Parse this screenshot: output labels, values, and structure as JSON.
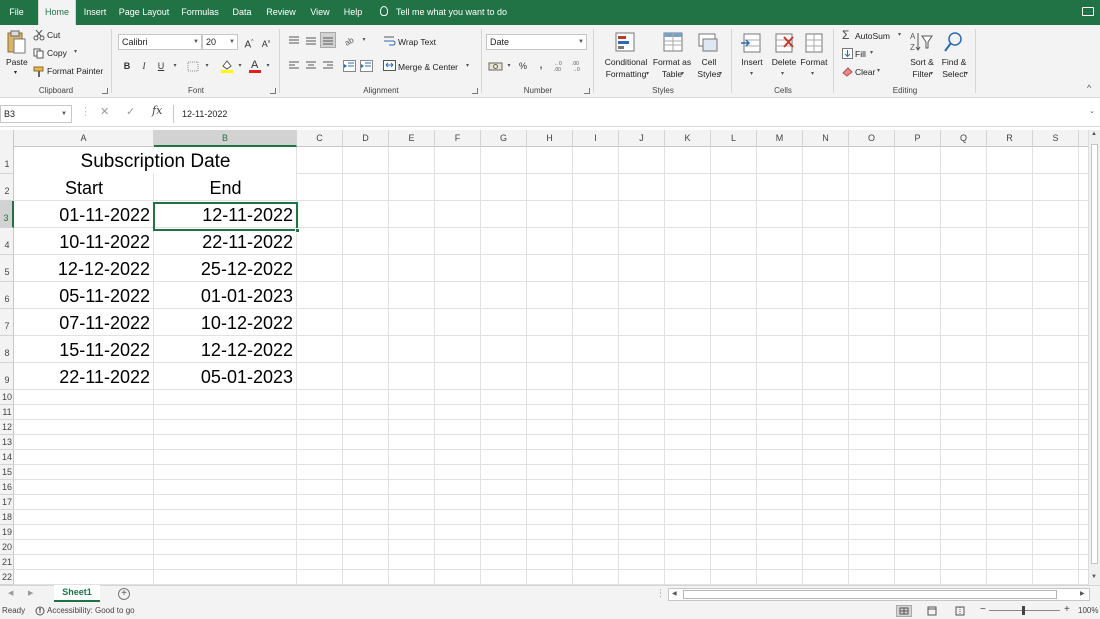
{
  "tabs": [
    "File",
    "Home",
    "Insert",
    "Page Layout",
    "Formulas",
    "Data",
    "Review",
    "View",
    "Help"
  ],
  "active_tab": "Home",
  "tell_me": "Tell me what you want to do",
  "ribbon": {
    "clipboard": {
      "name": "Clipboard",
      "paste": "Paste",
      "cut": "Cut",
      "copy": "Copy",
      "format_painter": "Format Painter"
    },
    "font": {
      "name": "Font",
      "family": "Calibri",
      "size": "20",
      "bold": "B",
      "italic": "I",
      "underline": "U"
    },
    "alignment": {
      "name": "Alignment",
      "wrap_text": "Wrap Text",
      "merge_center": "Merge & Center"
    },
    "number": {
      "name": "Number",
      "format": "Date",
      "percent": "%",
      "comma": ","
    },
    "styles": {
      "name": "Styles",
      "conditional_formatting_1": "Conditional",
      "conditional_formatting_2": "Formatting",
      "format_as_table_1": "Format as",
      "format_as_table_2": "Table",
      "cell_styles_1": "Cell",
      "cell_styles_2": "Styles"
    },
    "cells": {
      "name": "Cells",
      "insert": "Insert",
      "delete": "Delete",
      "format": "Format"
    },
    "editing": {
      "name": "Editing",
      "autosum": "AutoSum",
      "fill": "Fill",
      "clear": "Clear",
      "sort_filter_1": "Sort &",
      "sort_filter_2": "Filter",
      "find_select_1": "Find &",
      "find_select_2": "Select"
    }
  },
  "formula_bar": {
    "name_box": "B3",
    "fx": "fx",
    "content": "12-11-2022"
  },
  "columns": [
    "A",
    "B",
    "C",
    "D",
    "E",
    "F",
    "G",
    "H",
    "I",
    "J",
    "K",
    "L",
    "M",
    "N",
    "O",
    "P",
    "Q",
    "R",
    "S"
  ],
  "rows": [
    "1",
    "2",
    "3",
    "4",
    "5",
    "6",
    "7",
    "8",
    "9",
    "10",
    "11",
    "12",
    "13",
    "14",
    "15",
    "16",
    "17",
    "18",
    "19",
    "20",
    "21",
    "22"
  ],
  "sheet": {
    "title": "Subscription Date",
    "header_start": "Start",
    "header_end": "End",
    "start_dates": [
      "01-11-2022",
      "10-11-2022",
      "12-12-2022",
      "05-11-2022",
      "07-11-2022",
      "15-11-2022",
      "22-11-2022"
    ],
    "end_dates": [
      "12-11-2022",
      "22-11-2022",
      "25-12-2022",
      "01-01-2023",
      "10-12-2022",
      "12-12-2022",
      "05-01-2023"
    ]
  },
  "sheet_tab": "Sheet1",
  "status": {
    "ready": "Ready",
    "accessibility": "Accessibility: Good to go",
    "zoom": "100%"
  },
  "colors": {
    "accent": "#217346",
    "ribbon_bg": "#f3f3f3",
    "gridline": "#e1e1e1"
  }
}
